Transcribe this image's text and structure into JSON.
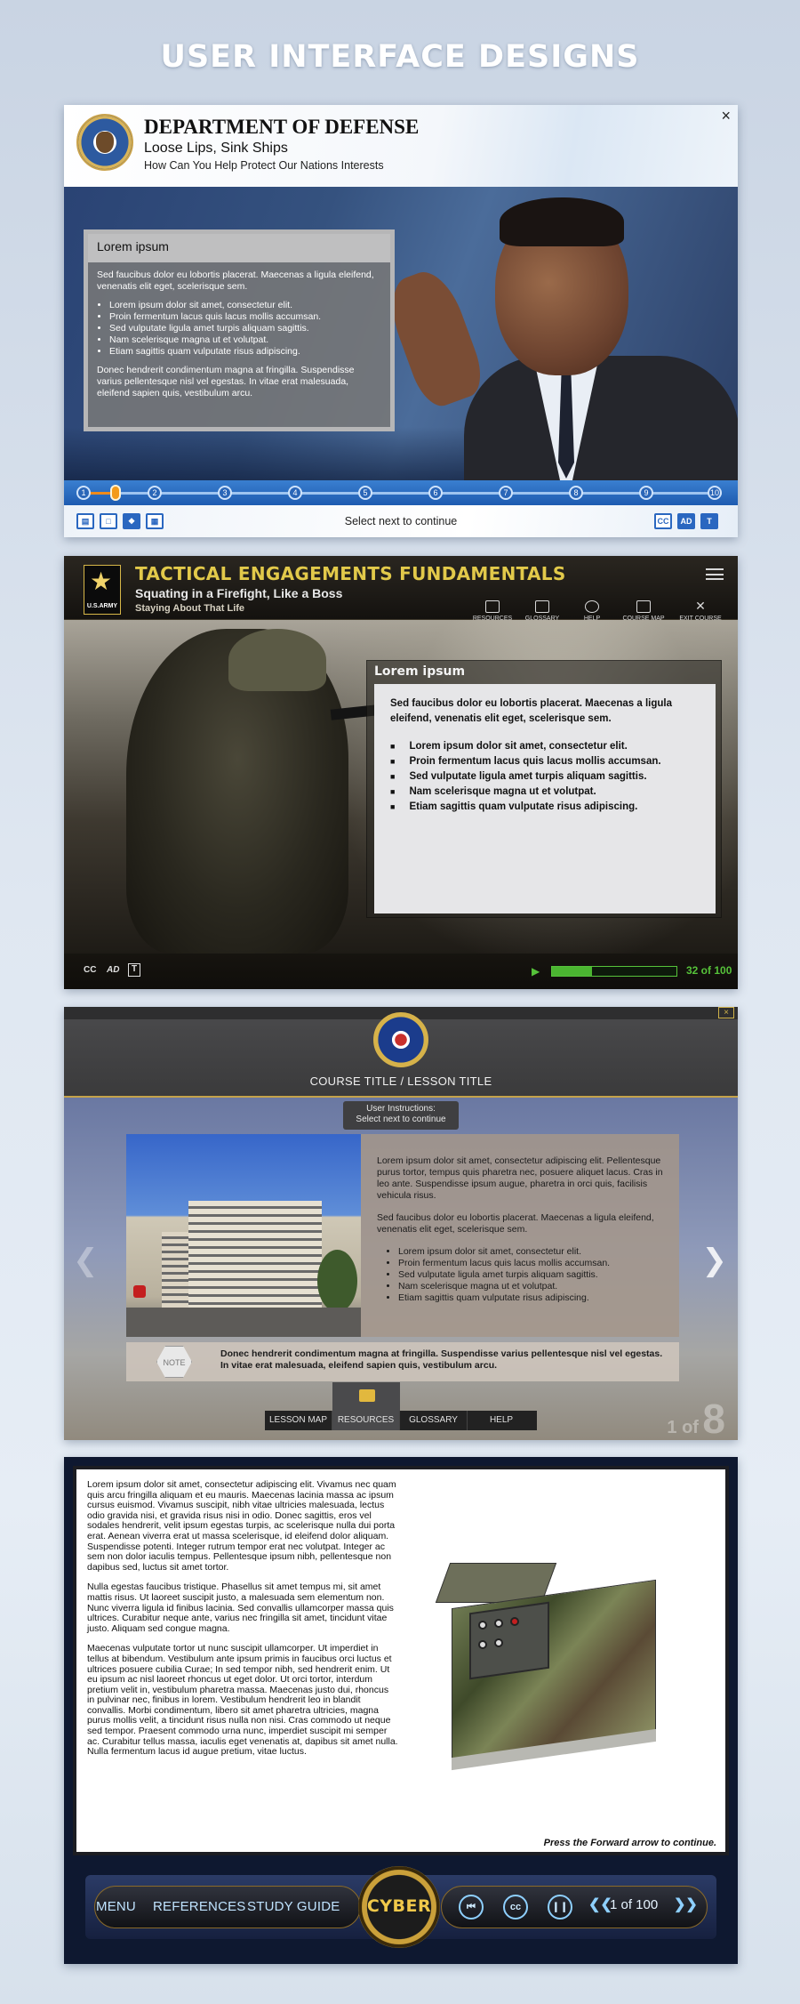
{
  "page": {
    "title": "USER INTERFACE DESIGNS"
  },
  "dod": {
    "title": "DEPARTMENT OF DEFENSE",
    "subtitle": "Loose Lips, Sink Ships",
    "tagline": "How Can You Help Protect Our Nations Interests",
    "close": "×",
    "box_title": "Lorem ipsum",
    "box_intro": "Sed faucibus dolor eu lobortis placerat. Maecenas a ligula eleifend, venenatis elit eget, scelerisque sem.",
    "bullets": [
      "Lorem ipsum dolor sit amet, consectetur elit.",
      "Proin fermentum lacus quis lacus mollis accumsan.",
      "Sed vulputate ligula amet turpis aliquam sagittis.",
      "Nam scelerisque magna ut et volutpat.",
      "Etiam sagittis quam vulputate risus adipiscing."
    ],
    "box_outro": "Donec hendrerit condimentum magna at fringilla. Suspendisse varius pellentesque nisl vel egestas. In vitae erat malesuada, eleifend sapien quis, vestibulum arcu.",
    "steps": [
      "1",
      "2",
      "3",
      "4",
      "5",
      "6",
      "7",
      "8",
      "9",
      "10"
    ],
    "footer_text": "Select next to continue",
    "cc_label": "CC",
    "ad_label": "AD",
    "t_label": "T"
  },
  "army": {
    "logo_text": "U.S.ARMY",
    "title": "TACTICAL ENGAGEMENTS FUNDAMENTALS",
    "subtitle": "Squating in a Firefight, Like a Boss",
    "tagline": "Staying About That Life",
    "nav": [
      "RESOURCES",
      "GLOSSARY",
      "HELP",
      "COURSE MAP",
      "EXIT COURSE"
    ],
    "box_title": "Lorem ipsum",
    "box_intro": "Sed faucibus dolor eu lobortis placerat. Maecenas a ligula eleifend, venenatis elit eget, scelerisque sem.",
    "bullets": [
      "Lorem ipsum dolor sit amet, consectetur elit.",
      "Proin fermentum lacus quis lacus mollis accumsan.",
      "Sed vulputate ligula amet turpis aliquam sagittis.",
      "Nam scelerisque magna ut et volutpat.",
      "Etiam sagittis quam vulputate risus adipiscing."
    ],
    "cc_label": "CC",
    "ad_label": "AD",
    "t_label": "T",
    "progress_current": 32,
    "progress_total": 100,
    "progress_text": "32 of 100"
  },
  "fbi": {
    "close": "×",
    "breadcrumb": "COURSE TITLE  /  LESSON TITLE",
    "instructions_1": "User Instructions:",
    "instructions_2": "Select next to continue",
    "para1": "Lorem ipsum dolor sit amet, consectetur adipiscing elit. Pellentesque purus tortor, tempus quis pharetra nec, posuere aliquet lacus. Cras in leo ante. Suspendisse ipsum augue, pharetra in orci quis, facilisis vehicula risus.",
    "para2": "Sed faucibus dolor eu lobortis placerat. Maecenas a ligula eleifend, venenatis elit eget, scelerisque sem.",
    "bullets": [
      "Lorem ipsum dolor sit amet, consectetur elit.",
      "Proin fermentum lacus quis lacus mollis accumsan.",
      "Sed vulputate ligula amet turpis aliquam sagittis.",
      "Nam scelerisque magna ut et volutpat.",
      "Etiam sagittis quam vulputate risus adipiscing."
    ],
    "note_label": "NOTE",
    "note_text": "Donec hendrerit condimentum magna at fringilla. Suspendisse varius pellentesque nisl vel egestas. In vitae erat malesuada, eleifend sapien quis, vestibulum arcu.",
    "tabs": [
      "LESSON MAP",
      "RESOURCES",
      "GLOSSARY",
      "HELP"
    ],
    "page_current": "1 of",
    "page_total": "8"
  },
  "cyber": {
    "para1": "Lorem ipsum dolor sit amet, consectetur adipiscing elit. Vivamus nec quam quis arcu fringilla aliquam et eu mauris. Maecenas lacinia massa ac ipsum cursus euismod. Vivamus suscipit, nibh vitae ultricies malesuada, lectus odio gravida nisi, et gravida risus nisi in odio. Donec sagittis, eros vel sodales hendrerit, velit ipsum egestas turpis, ac scelerisque nulla dui porta erat. Aenean viverra erat ut massa scelerisque, id eleifend dolor aliquam. Suspendisse potenti. Integer rutrum tempor erat nec volutpat. Integer ac sem non dolor iaculis tempus. Pellentesque ipsum nibh, pellentesque non dapibus sed, luctus sit amet tortor.",
    "para2": "Nulla egestas faucibus tristique. Phasellus sit amet tempus mi, sit amet mattis risus. Ut laoreet suscipit justo, a malesuada sem elementum non. Nunc viverra ligula id finibus lacinia. Sed convallis ullamcorper massa quis ultrices. Curabitur neque ante, varius nec fringilla sit amet, tincidunt vitae justo. Aliquam sed congue magna.",
    "para3": "Maecenas vulputate tortor ut nunc suscipit ullamcorper. Ut imperdiet in tellus at bibendum. Vestibulum ante ipsum primis in faucibus orci luctus et ultrices posuere cubilia Curae; In sed tempor nibh, sed hendrerit enim. Ut eu ipsum ac nisl laoreet rhoncus ut eget dolor. Ut orci tortor, interdum pretium velit in, vestibulum pharetra massa. Maecenas justo dui, rhoncus in pulvinar nec, finibus in lorem. Vestibulum hendrerit leo in blandit convallis. Morbi condimentum, libero sit amet pharetra ultricies, magna purus mollis velit, a tincidunt risus nulla non nisi. Cras commodo ut neque sed tempor. Praesent commodo urna nunc, imperdiet suscipit mi semper ac. Curabitur tellus massa, iaculis eget venenatis at, dapibus sit amet nulla. Nulla fermentum lacus id augue pretium, vitae luctus.",
    "forward_hint": "Press the Forward arrow to continue.",
    "nav": [
      "MENU",
      "REFERENCES",
      "STUDY GUIDE"
    ],
    "badge": "CYBER",
    "cc_label": "cc",
    "pager": "1 of 100"
  }
}
